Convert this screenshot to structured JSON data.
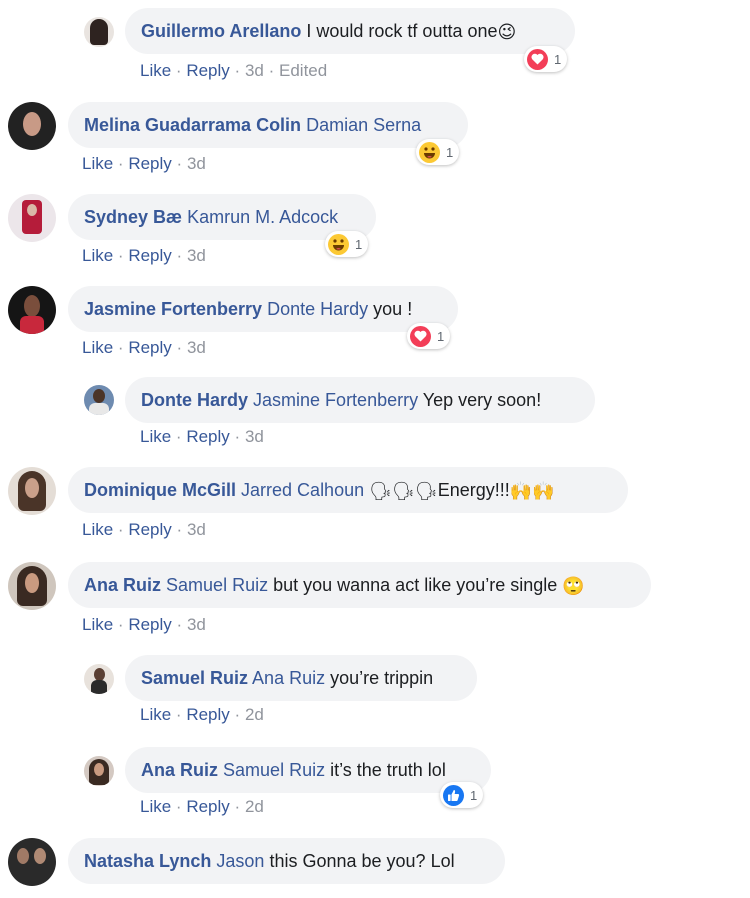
{
  "comments": [
    {
      "author": "Guillermo Arellano",
      "mention": "",
      "text": "I would rock tf outta one",
      "emoji": "😉",
      "like": "Like",
      "reply": "Reply",
      "time": "3d",
      "edited": "Edited",
      "reaction": {
        "type": "love",
        "count": "1"
      }
    },
    {
      "author": "Melina Guadarrama Colin",
      "mention": "Damian Serna",
      "text": "",
      "like": "Like",
      "reply": "Reply",
      "time": "3d",
      "reaction": {
        "type": "haha",
        "count": "1"
      }
    },
    {
      "author": "Sydney Bæ",
      "mention": "Kamrun M. Adcock",
      "text": "",
      "like": "Like",
      "reply": "Reply",
      "time": "3d",
      "reaction": {
        "type": "haha",
        "count": "1"
      }
    },
    {
      "author": "Jasmine Fortenberry",
      "mention": "Donte Hardy",
      "text": "you !",
      "like": "Like",
      "reply": "Reply",
      "time": "3d",
      "reaction": {
        "type": "love",
        "count": "1"
      }
    },
    {
      "author": "Donte Hardy",
      "mention": "Jasmine Fortenberry",
      "text": "Yep very soon!",
      "like": "Like",
      "reply": "Reply",
      "time": "3d"
    },
    {
      "author": "Dominique McGill",
      "mention": "Jarred Calhoun",
      "text": "Energy!!!",
      "emoji": "🗣🗣🗣",
      "emoji2": "🙌🙌",
      "like": "Like",
      "reply": "Reply",
      "time": "3d"
    },
    {
      "author": "Ana Ruiz",
      "mention": "Samuel Ruiz",
      "text": "but you wanna act like you’re single",
      "emoji": "🙄",
      "like": "Like",
      "reply": "Reply",
      "time": "3d"
    },
    {
      "author": "Samuel Ruiz",
      "mention": "Ana Ruiz",
      "text": "you’re trippin",
      "like": "Like",
      "reply": "Reply",
      "time": "2d"
    },
    {
      "author": "Ana Ruiz",
      "mention": "Samuel Ruiz",
      "text": "it’s the truth lol",
      "like": "Like",
      "reply": "Reply",
      "time": "2d",
      "reaction": {
        "type": "like",
        "count": "1"
      }
    },
    {
      "author": "Natasha Lynch",
      "mention": "Jason",
      "text": "this Gonna be you? Lol"
    }
  ],
  "colors": {
    "link": "#385898",
    "meta": "#90949c",
    "bubble": "#f2f3f5",
    "love": "#f33e58",
    "haha": "#fcc934",
    "like": "#1877f2"
  },
  "icons": {
    "love": "heart-icon",
    "haha": "laughing-face-icon",
    "like": "thumbs-up-icon"
  },
  "separator": "·"
}
